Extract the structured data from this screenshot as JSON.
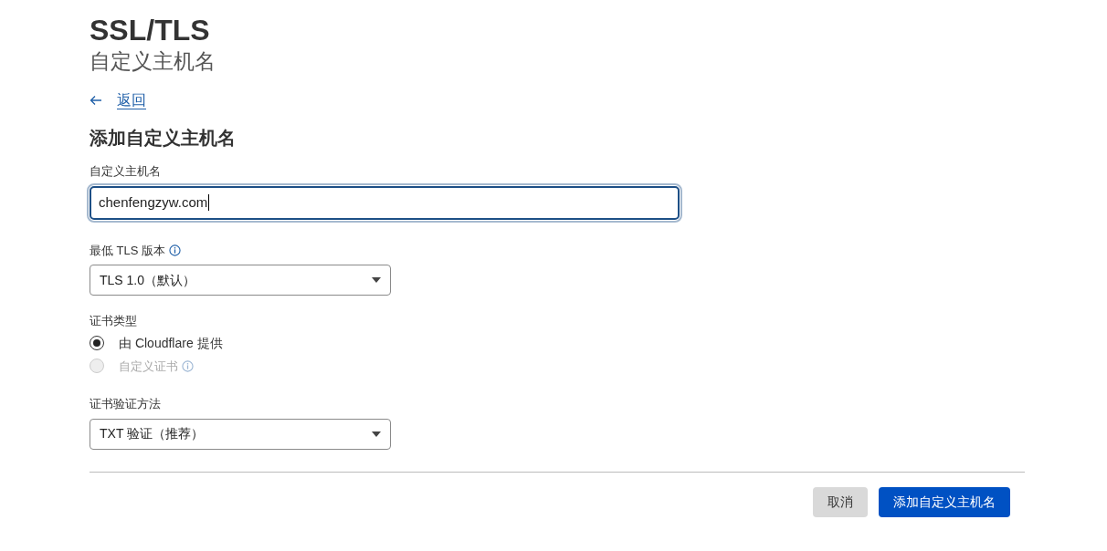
{
  "header": {
    "title": "SSL/TLS",
    "subtitle": "自定义主机名"
  },
  "back_link": {
    "label": "返回"
  },
  "form": {
    "heading": "添加自定义主机名",
    "hostname": {
      "label": "自定义主机名",
      "value": "chenfengzyw.com",
      "focused": true
    },
    "tls": {
      "label": "最低 TLS 版本",
      "has_info": true,
      "value": "TLS 1.0（默认）"
    },
    "cert_type": {
      "label": "证书类型",
      "options": [
        {
          "label": "由 Cloudflare 提供",
          "selected": true,
          "disabled": false,
          "has_info": false
        },
        {
          "label": "自定义证书",
          "selected": false,
          "disabled": true,
          "has_info": true
        }
      ]
    },
    "validation": {
      "label": "证书验证方法",
      "value": "TXT 验证（推荐）"
    }
  },
  "buttons": [
    {
      "label": "取消",
      "kind": "secondary"
    },
    {
      "label": "添加自定义主机名",
      "kind": "primary"
    }
  ]
}
